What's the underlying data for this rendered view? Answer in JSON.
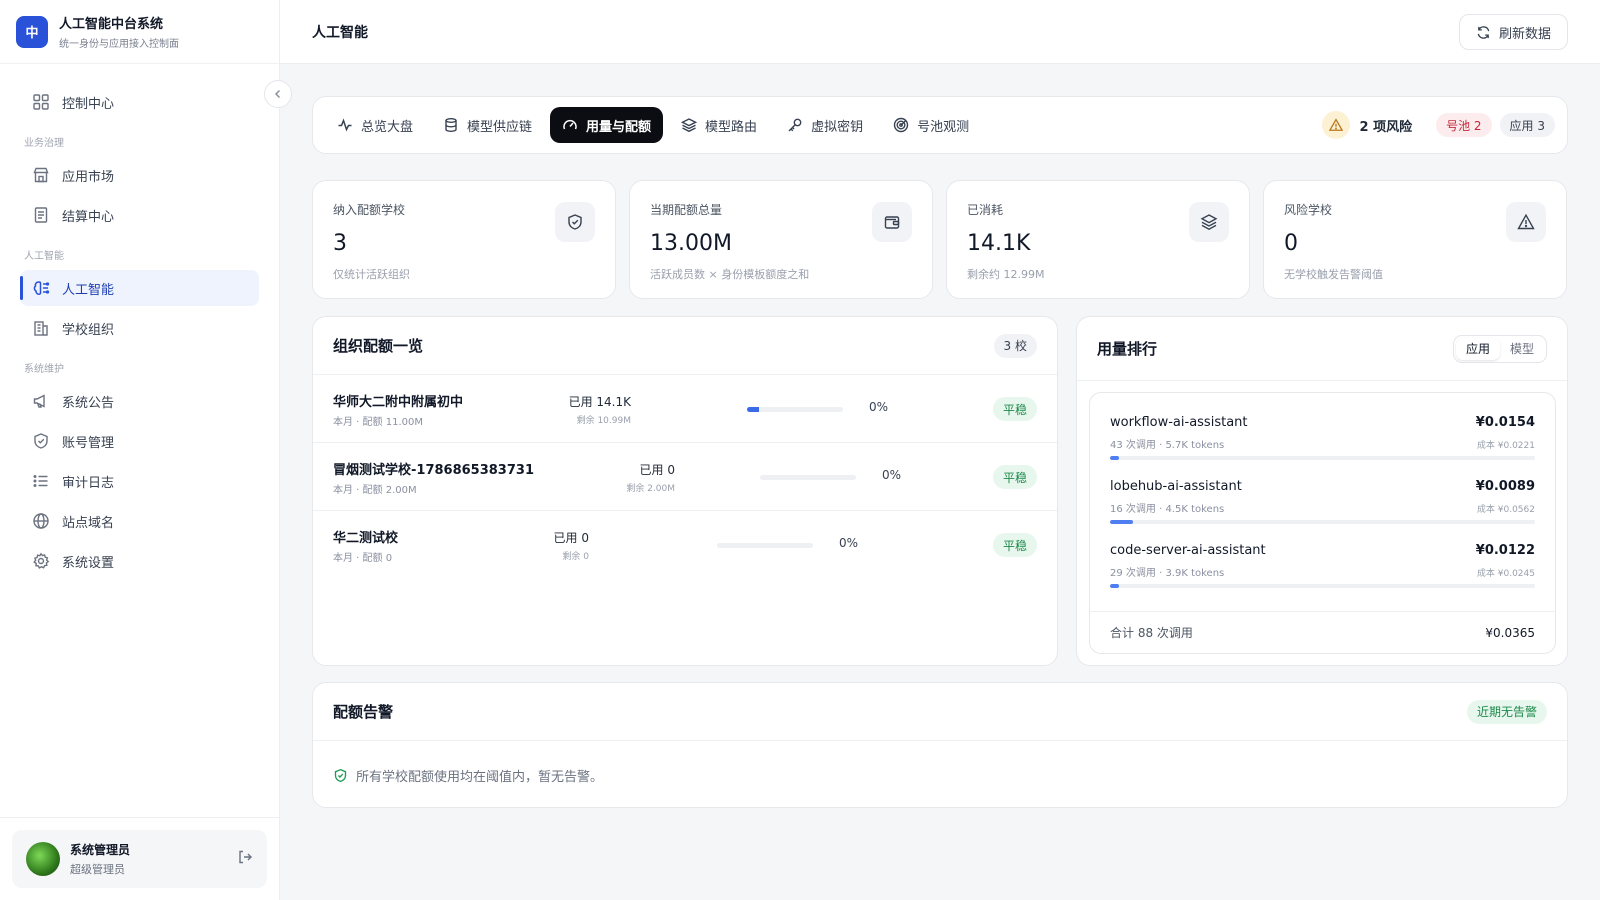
{
  "brand": {
    "logo_char": "中",
    "title": "人工智能中台系统",
    "subtitle": "统一身份与应用接入控制面"
  },
  "nav": {
    "top": [
      {
        "label": "控制中心",
        "icon": "grid-icon"
      }
    ],
    "groups": [
      {
        "label": "业务治理",
        "items": [
          {
            "label": "应用市场",
            "icon": "store-icon"
          },
          {
            "label": "结算中心",
            "icon": "receipt-icon"
          }
        ]
      },
      {
        "label": "人工智能",
        "items": [
          {
            "label": "人工智能",
            "icon": "brain-icon",
            "active": true
          },
          {
            "label": "学校组织",
            "icon": "building-icon"
          }
        ]
      },
      {
        "label": "系统维护",
        "items": [
          {
            "label": "系统公告",
            "icon": "megaphone-icon"
          },
          {
            "label": "账号管理",
            "icon": "shield-icon"
          },
          {
            "label": "审计日志",
            "icon": "list-icon"
          },
          {
            "label": "站点域名",
            "icon": "globe-icon"
          },
          {
            "label": "系统设置",
            "icon": "gear-icon"
          }
        ]
      }
    ]
  },
  "user": {
    "name": "系统管理员",
    "role": "超级管理员"
  },
  "topbar": {
    "title": "人工智能",
    "refresh_label": "刷新数据"
  },
  "tabs": [
    {
      "label": "总览大盘",
      "icon": "activity-icon"
    },
    {
      "label": "模型供应链",
      "icon": "database-icon"
    },
    {
      "label": "用量与配额",
      "icon": "gauge-icon",
      "active": true
    },
    {
      "label": "模型路由",
      "icon": "layers-icon"
    },
    {
      "label": "虚拟密钥",
      "icon": "key-icon"
    },
    {
      "label": "号池观测",
      "icon": "radar-icon"
    }
  ],
  "risk": {
    "label": "2 项风险",
    "pool_badge": "号池 2",
    "app_badge": "应用 3"
  },
  "stats": [
    {
      "label": "纳入配额学校",
      "value": "3",
      "sub": "仅统计活跃组织",
      "icon": "shield-check-icon"
    },
    {
      "label": "当期配额总量",
      "value": "13.00M",
      "sub": "活跃成员数 × 身份模板额度之和",
      "icon": "wallet-icon"
    },
    {
      "label": "已消耗",
      "value": "14.1K",
      "sub": "剩余约 12.99M",
      "icon": "layers-icon"
    },
    {
      "label": "风险学校",
      "value": "0",
      "sub": "无学校触发告警阈值",
      "icon": "alert-triangle-icon"
    }
  ],
  "org_panel": {
    "title": "组织配额一览",
    "count_badge": "3 校",
    "rows": [
      {
        "name": "华师大二附中附属初中",
        "meta": "本月 · 配额 11.00M",
        "used": "已用 14.1K",
        "remaining": "剩余 10.99M",
        "percent_label": "0%",
        "percent": 0.13,
        "status": "平稳"
      },
      {
        "name": "冒烟测试学校-1786865383731",
        "meta": "本月 · 配额 2.00M",
        "used": "已用 0",
        "remaining": "剩余 2.00M",
        "percent_label": "0%",
        "percent": 0,
        "status": "平稳"
      },
      {
        "name": "华二测试校",
        "meta": "本月 · 配额 0",
        "used": "已用 0",
        "remaining": "剩余 0",
        "percent_label": "0%",
        "percent": 0,
        "status": "平稳"
      }
    ]
  },
  "rank_panel": {
    "title": "用量排行",
    "segments": [
      "应用",
      "模型"
    ],
    "active_segment": "应用",
    "items": [
      {
        "name": "workflow-ai-assistant",
        "meta": "43 次调用 · 5.7K tokens",
        "cost": "¥0.0154",
        "cost_detail": "成本 ¥0.0221",
        "share": 0.02
      },
      {
        "name": "lobehub-ai-assistant",
        "meta": "16 次调用 · 4.5K tokens",
        "cost": "¥0.0089",
        "cost_detail": "成本 ¥0.0562",
        "share": 0.055
      },
      {
        "name": "code-server-ai-assistant",
        "meta": "29 次调用 · 3.9K tokens",
        "cost": "¥0.0122",
        "cost_detail": "成本 ¥0.0245",
        "share": 0.022
      }
    ],
    "footer_label": "合计 88 次调用",
    "footer_total": "¥0.0365"
  },
  "alert_panel": {
    "title": "配额告警",
    "badge": "近期无告警",
    "message": "所有学校配额使用均在阈值内，暂无告警。"
  }
}
